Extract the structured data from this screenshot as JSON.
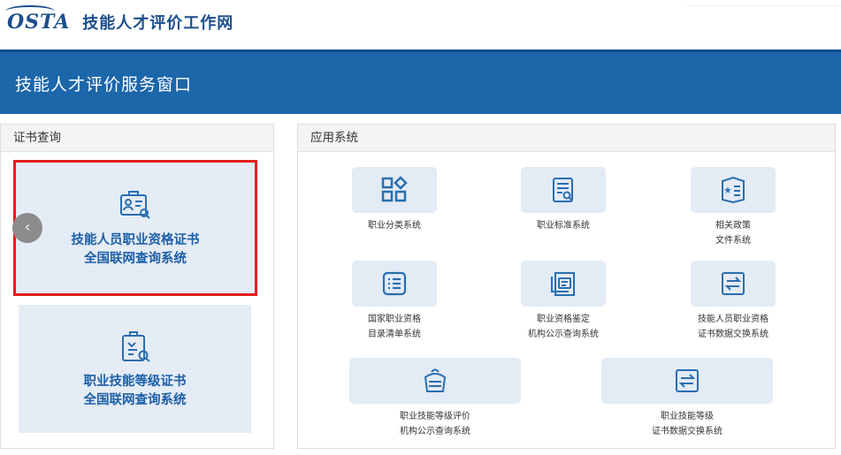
{
  "header": {
    "logo_mark": "OSTA",
    "logo_text": "技能人才评价工作网"
  },
  "banner": {
    "title": "技能人才评价服务窗口"
  },
  "cert_panel": {
    "title": "证书查询",
    "cards": [
      {
        "line1": "技能人员职业资格证书",
        "line2": "全国联网查询系统",
        "icon": "certificate-search-icon",
        "selected": true
      },
      {
        "line1": "职业技能等级证书",
        "line2": "全国联网查询系统",
        "icon": "clipboard-search-icon",
        "selected": false
      }
    ]
  },
  "app_panel": {
    "title": "应用系统",
    "items": [
      {
        "label": "职业分类系统",
        "icon": "category-grid-icon"
      },
      {
        "label": "职业标准系统",
        "icon": "standard-document-icon"
      },
      {
        "label": "相关政策\n文件系统",
        "icon": "policy-book-icon"
      },
      {
        "label": "国家职业资格\n目录清单系统",
        "icon": "list-icon"
      },
      {
        "label": "职业资格鉴定\n机构公示查询系统",
        "icon": "stacked-documents-icon"
      },
      {
        "label": "技能人员职业资格\n证书数据交换系统",
        "icon": "exchange-arrows-icon"
      },
      {
        "label": "职业技能等级评价\n机构公示查询系统",
        "icon": "archive-basket-icon"
      },
      {
        "label": "职业技能等级\n证书数据交换系统",
        "icon": "exchange-arrows-icon"
      }
    ]
  },
  "colors": {
    "brand_blue": "#1c66aa",
    "accent_text": "#1c5fa8",
    "tile_bg": "#e3ebf5",
    "highlight_border": "#e31c1c"
  }
}
